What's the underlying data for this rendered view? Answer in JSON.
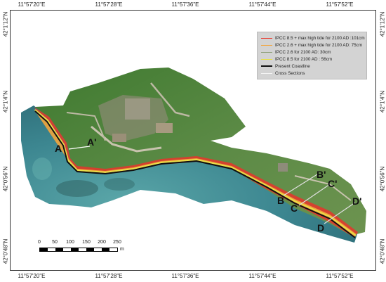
{
  "coordinates": {
    "top": [
      "11°57'20\"E",
      "11°57'28\"E",
      "11°57'36\"E",
      "11°57'44\"E",
      "11°57'52\"E"
    ],
    "bottom": [
      "11°57'20\"E",
      "11°57'28\"E",
      "11°57'36\"E",
      "11°57'44\"E",
      "11°57'52\"E"
    ],
    "left": [
      "42°1'12\"N",
      "42°1'4\"N",
      "42°0'56\"N",
      "42°0'48\"N"
    ],
    "right": [
      "42°1'12\"N",
      "42°1'4\"N",
      "42°0'56\"N",
      "42°0'48\"N"
    ]
  },
  "legend": {
    "items": [
      {
        "label": "IPCC 8.5 + max high tide for 2100 AD :101cm",
        "color": "#e8352b"
      },
      {
        "label": "IPCC 2.6 + max high tide for 2100 AD: 75cm",
        "color": "#f2a53c"
      },
      {
        "label": "IPCC 2.6 for 2100 AD: 30cm",
        "color": "#8fa07a"
      },
      {
        "label": "IPCC 8.5 for 2100 AD : 56cm",
        "color": "#e8e04a"
      },
      {
        "label": "Present Coastline",
        "color": "#111111"
      },
      {
        "label": "Cross Sections",
        "color": "#e9e9e9"
      }
    ]
  },
  "cross_sections": {
    "labels": [
      "A",
      "A'",
      "B",
      "B'",
      "C",
      "C'",
      "D",
      "D'"
    ]
  },
  "scalebar": {
    "ticks": [
      "0",
      "50",
      "100",
      "150",
      "200",
      "250"
    ],
    "unit": "m"
  },
  "colors": {
    "sea": "#3f8c94",
    "land": "#4f7f3a",
    "flood_101": "#e8352b",
    "flood_75": "#f2a53c",
    "flood_56": "#e8e04a",
    "coastline": "#111111"
  }
}
